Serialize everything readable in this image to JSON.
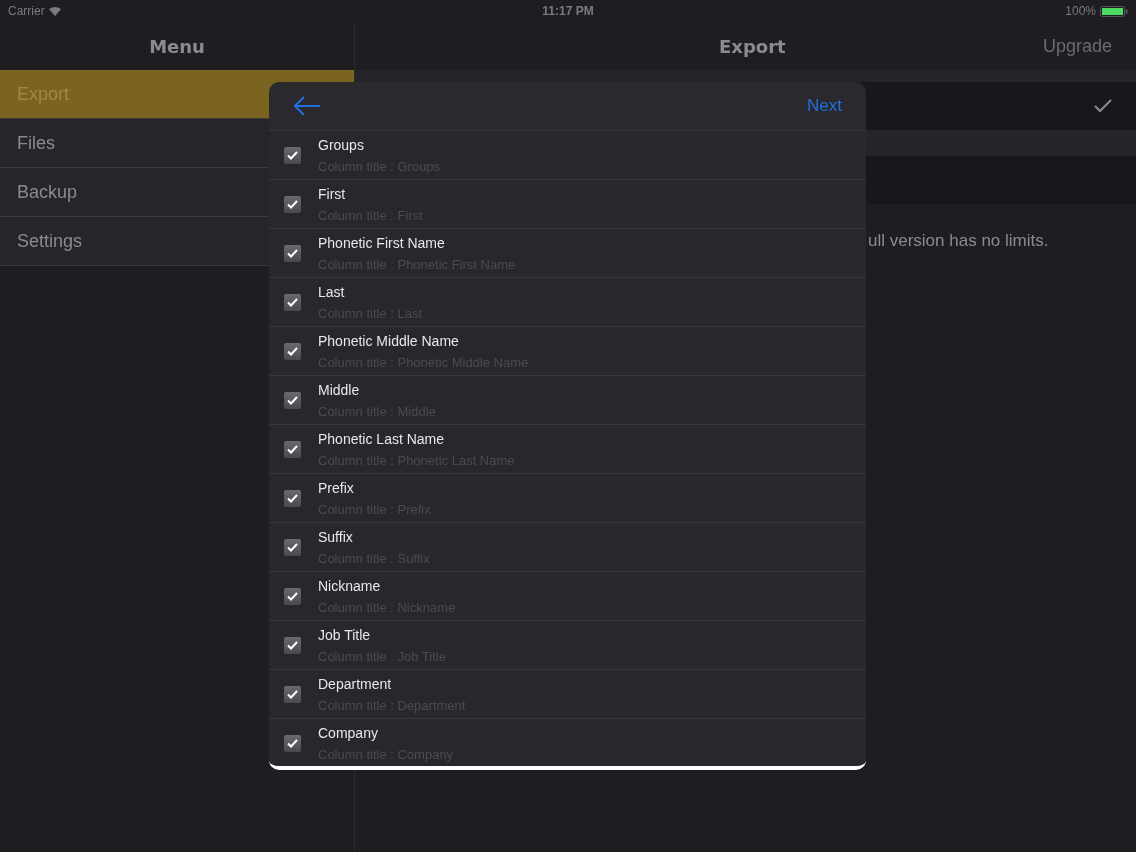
{
  "status_bar": {
    "carrier": "Carrier",
    "time": "11:17 PM",
    "battery": "100%"
  },
  "sidebar": {
    "title": "Menu",
    "items": [
      {
        "label": "Export",
        "selected": true
      },
      {
        "label": "Files",
        "selected": false
      },
      {
        "label": "Backup",
        "selected": false
      },
      {
        "label": "Settings",
        "selected": false
      }
    ]
  },
  "main": {
    "title": "Export",
    "upgrade": "Upgrade",
    "note": "ull version has no limits."
  },
  "dialog": {
    "next": "Next",
    "fields": [
      {
        "label": "Groups",
        "placeholder": "Column title : Groups",
        "checked": true
      },
      {
        "label": "First",
        "placeholder": "Column title : First",
        "checked": true
      },
      {
        "label": "Phonetic First Name",
        "placeholder": "Column title : Phonetic First Name",
        "checked": true
      },
      {
        "label": "Last",
        "placeholder": "Column title : Last",
        "checked": true
      },
      {
        "label": "Phonetic Middle Name",
        "placeholder": "Column title : Phonetic Middle Name",
        "checked": true
      },
      {
        "label": "Middle",
        "placeholder": "Column title : Middle",
        "checked": true
      },
      {
        "label": "Phonetic Last Name",
        "placeholder": "Column title : Phonetic Last Name",
        "checked": true
      },
      {
        "label": "Prefix",
        "placeholder": "Column title : Prefix",
        "checked": true
      },
      {
        "label": "Suffix",
        "placeholder": "Column title : Suffix",
        "checked": true
      },
      {
        "label": "Nickname",
        "placeholder": "Column title : Nickname",
        "checked": true
      },
      {
        "label": "Job Title",
        "placeholder": "Column title : Job Title",
        "checked": true
      },
      {
        "label": "Department",
        "placeholder": "Column title : Department",
        "checked": true
      },
      {
        "label": "Company",
        "placeholder": "Column title : Company",
        "checked": true
      }
    ]
  }
}
